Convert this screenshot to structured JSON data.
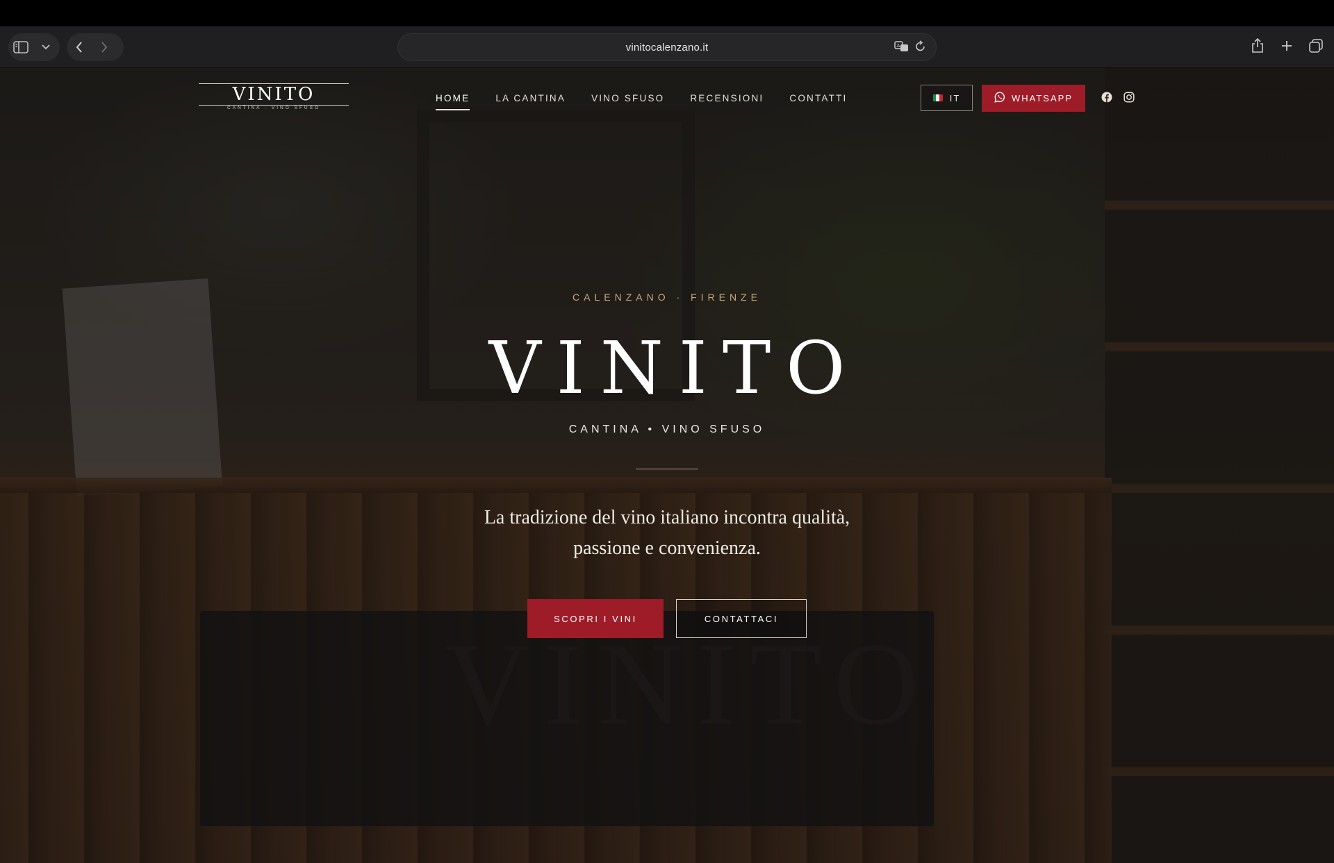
{
  "browser": {
    "url": "vinitocalenzano.it"
  },
  "site": {
    "logo": {
      "name": "VINITO",
      "subtitle": "CANTINA · VINO SFUSO"
    },
    "nav": [
      {
        "label": "HOME",
        "active": true
      },
      {
        "label": "LA CANTINA",
        "active": false
      },
      {
        "label": "VINO SFUSO",
        "active": false
      },
      {
        "label": "RECENSIONI",
        "active": false
      },
      {
        "label": "CONTATTI",
        "active": false
      }
    ],
    "language": {
      "label": "IT",
      "flag_icon": "italy-flag-icon"
    },
    "whatsapp": {
      "label": "WHATSAPP",
      "icon": "whatsapp-icon"
    },
    "social": [
      {
        "name": "facebook-icon"
      },
      {
        "name": "instagram-icon"
      }
    ]
  },
  "hero": {
    "kicker": "CALENZANO · FIRENZE",
    "title": "VINITO",
    "subtitle": "CANTINA • VINO SFUSO",
    "description_line1": "La tradizione del vino italiano incontra qualità,",
    "description_line2": "passione e convenienza.",
    "primary_button": "SCOPRI I VINI",
    "secondary_button": "CONTATTACI",
    "background_sign_text": "VINITO"
  },
  "colors": {
    "accent_red": "#9e1c28",
    "kicker_gold": "#c9a87a"
  }
}
